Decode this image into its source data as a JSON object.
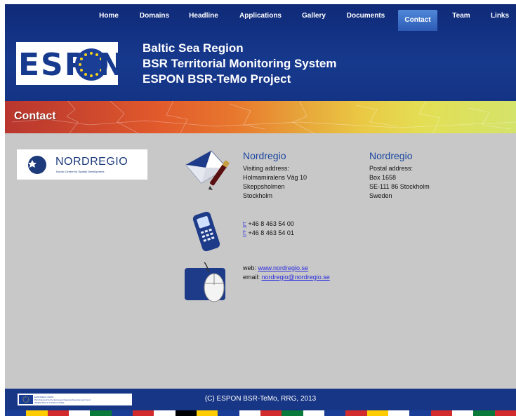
{
  "nav": [
    {
      "label": "Home"
    },
    {
      "label": "Domains"
    },
    {
      "label": "Headline"
    },
    {
      "label": "Applications"
    },
    {
      "label": "Gallery"
    },
    {
      "label": "Documents"
    },
    {
      "label": "Contact",
      "active": true
    },
    {
      "label": "Team"
    },
    {
      "label": "Links"
    }
  ],
  "header": {
    "logo_left": "ESP",
    "logo_right": "N",
    "title_lines": [
      "Baltic Sea Region",
      "BSR Territorial Monitoring System",
      "ESPON BSR-TeMo Project"
    ]
  },
  "banner": {
    "title": "Contact"
  },
  "partner_logo": {
    "name": "NORDREGIO",
    "subtitle": "Nordic Centre for Spatial Development"
  },
  "visiting": {
    "heading": "Nordregio",
    "lines": [
      "Visiting address:",
      "Holmamiralens Väg 10",
      "Skeppsholmen",
      "Stockholm"
    ]
  },
  "postal": {
    "heading": "Nordregio",
    "lines": [
      "Postal address:",
      "Box 1658",
      "SE-111 86 Stockholm",
      "Sweden"
    ]
  },
  "phone": {
    "tel_prefix": "t:",
    "tel": "+46 8 463 54 00",
    "fax_prefix": "f:",
    "fax": "+46 8 463 54 01"
  },
  "web": {
    "web_label": "web:",
    "web_link": "www.nordregio.se",
    "email_label": "email:",
    "email_link": "nordregio@nordregio.se"
  },
  "footer": {
    "eu_lines": [
      "EUROPEAN UNION",
      "Part-financed by the European Regional Development Fund",
      "INVESTING IN YOUR FUTURE"
    ],
    "copyright": "(C) ESPON BSR-TeMo, RRG, 2013"
  },
  "colors": {
    "header_bg": "#17398d",
    "page_bg": "#c8c8c8",
    "heading_blue": "#1a46a0",
    "link_blue": "#2a2ae0"
  },
  "icons": {
    "contact_mail": "envelope-pen-icon",
    "contact_phone": "mobile-phone-icon",
    "contact_web": "computer-mouse-icon",
    "eu_logo": "eu-flag-icon",
    "nordregio_mark": "globe-star-icon"
  }
}
